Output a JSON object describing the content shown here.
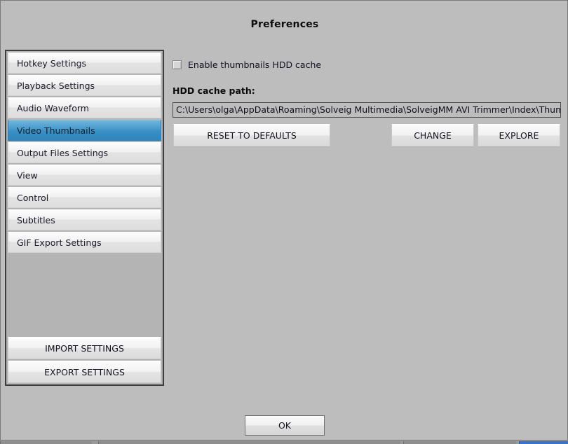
{
  "window": {
    "title": "Preferences"
  },
  "sidebar": {
    "items": [
      {
        "label": "Hotkey Settings",
        "selected": false
      },
      {
        "label": "Playback Settings",
        "selected": false
      },
      {
        "label": "Audio Waveform",
        "selected": false
      },
      {
        "label": "Video Thumbnails",
        "selected": true
      },
      {
        "label": "Output Files Settings",
        "selected": false
      },
      {
        "label": "View",
        "selected": false
      },
      {
        "label": "Control",
        "selected": false
      },
      {
        "label": "Subtitles",
        "selected": false
      },
      {
        "label": "GIF Export Settings",
        "selected": false
      }
    ],
    "import_label": "IMPORT SETTINGS",
    "export_label": "EXPORT SETTINGS"
  },
  "main": {
    "enable_cache_label": "Enable thumbnails HDD cache",
    "enable_cache_checked": false,
    "path_label": "HDD cache path:",
    "path_value": "C:\\Users\\olga\\AppData\\Roaming\\Solveig Multimedia\\SolveigMM AVI Trimmer\\Index\\ThumbsDB",
    "reset_label": "RESET TO DEFAULTS",
    "change_label": "CHANGE",
    "explore_label": "EXPLORE"
  },
  "footer": {
    "ok_label": "OK"
  },
  "colors": {
    "dialog_bg": "#bdbdbd",
    "selection_blue": "#3a8fc4",
    "desktop": "#b6b6b6"
  }
}
